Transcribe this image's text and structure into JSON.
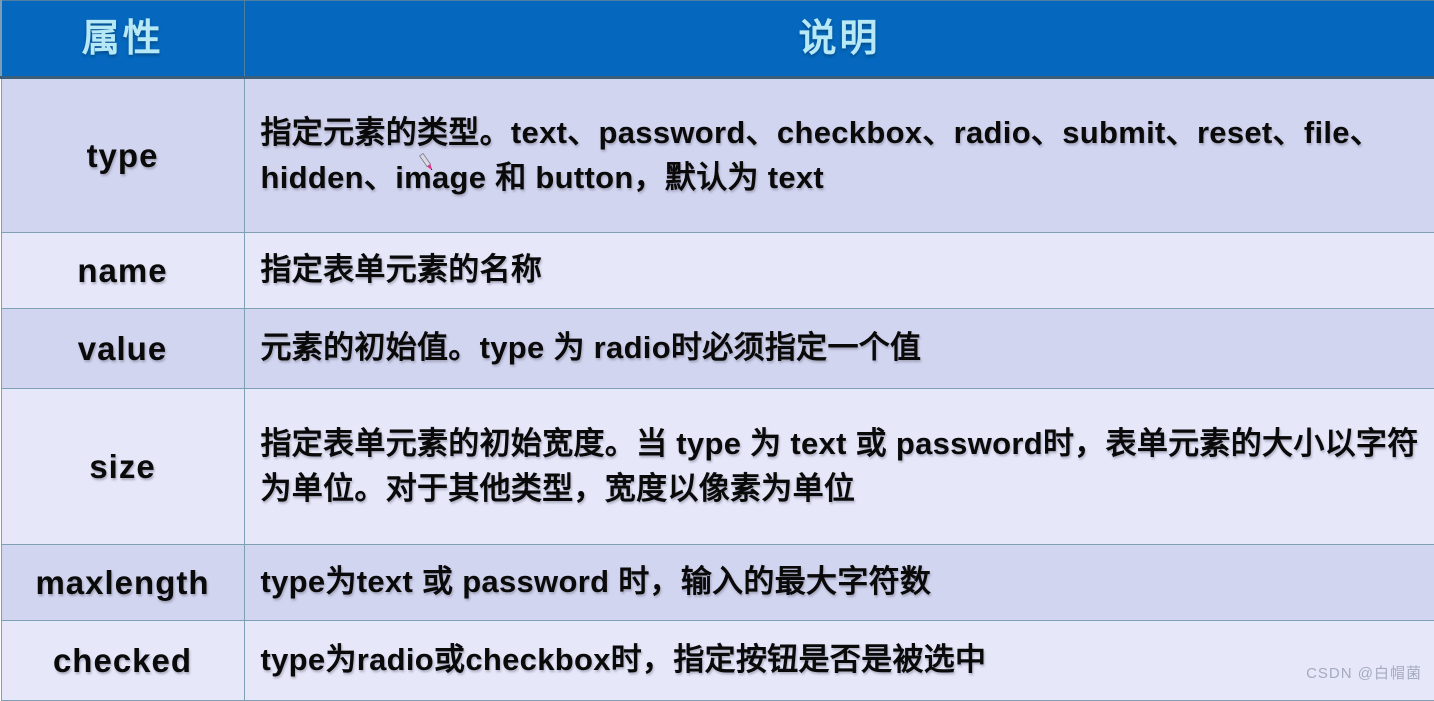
{
  "table": {
    "headers": {
      "attribute": "属性",
      "description": "说明"
    },
    "rows": [
      {
        "attribute": "type",
        "description": "指定元素的类型。text、password、checkbox、radio、submit、reset、file、hidden、image 和 button，默认为 text"
      },
      {
        "attribute": "name",
        "description": "指定表单元素的名称"
      },
      {
        "attribute": "value",
        "description": "元素的初始值。type 为 radio时必须指定一个值"
      },
      {
        "attribute": "size",
        "description": "指定表单元素的初始宽度。当 type 为 text 或 password时，表单元素的大小以字符为单位。对于其他类型，宽度以像素为单位"
      },
      {
        "attribute": "maxlength",
        "description": "type为text 或 password 时，输入的最大字符数"
      },
      {
        "attribute": "checked",
        "description": "type为radio或checkbox时，指定按钮是否是被选中"
      }
    ]
  },
  "watermark": {
    "text": "CSDN @白帽菌"
  },
  "colors": {
    "header_background": "#0568be",
    "header_text": "#b6e8f5",
    "row_dark": "#d2d5f0",
    "row_light": "#e6e8fa",
    "border": "#7f9fb5",
    "body_text": "#0a0a0a",
    "watermark_text": "#9aa0b4"
  }
}
